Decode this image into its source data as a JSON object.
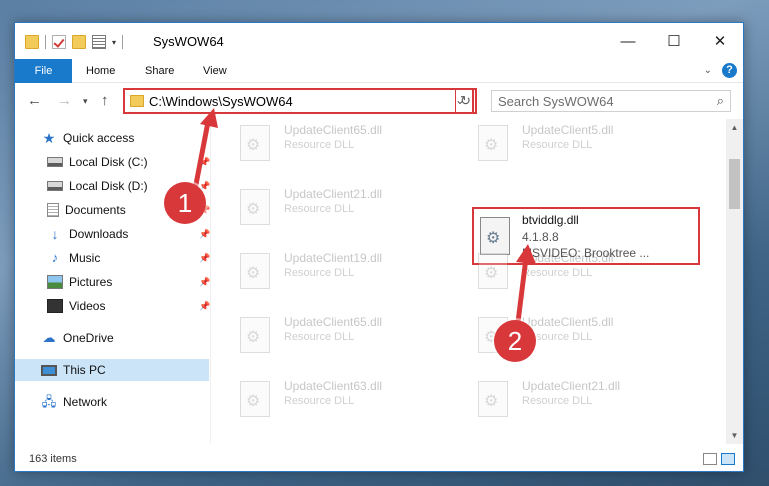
{
  "window": {
    "title": "SysWOW64",
    "controls": {
      "minimize": "—",
      "maximize": "☐",
      "close": "✕"
    }
  },
  "ribbon": {
    "tabs": [
      "File",
      "Home",
      "Share",
      "View"
    ],
    "help": "?"
  },
  "address_bar": {
    "path": "C:\\Windows\\SysWOW64",
    "search_placeholder": "Search SysWOW64"
  },
  "sidebar": {
    "items": [
      {
        "label": "Quick access",
        "icon": "star-icon"
      },
      {
        "label": "Local Disk (C:)",
        "icon": "disk-icon",
        "pinned": true
      },
      {
        "label": "Local Disk (D:)",
        "icon": "disk-icon",
        "pinned": true
      },
      {
        "label": "Documents",
        "icon": "documents-icon",
        "pinned": true
      },
      {
        "label": "Downloads",
        "icon": "downloads-icon",
        "pinned": true
      },
      {
        "label": "Music",
        "icon": "music-icon",
        "pinned": true
      },
      {
        "label": "Pictures",
        "icon": "pictures-icon",
        "pinned": true
      },
      {
        "label": "Videos",
        "icon": "videos-icon",
        "pinned": true
      },
      {
        "label": "OneDrive",
        "icon": "onedrive-icon"
      },
      {
        "label": "This PC",
        "icon": "this-pc-icon",
        "selected": true
      },
      {
        "label": "Network",
        "icon": "network-icon"
      }
    ]
  },
  "files": [
    {
      "name": "UpdateClient65.dll",
      "type": "Resource DLL"
    },
    {
      "name": "UpdateClient5.dll",
      "type": "Resource DLL"
    },
    {
      "name": "UpdateClient21.dll",
      "type": "Resource DLL"
    },
    {
      "name": "UpdateClient19.dll",
      "type": "Resource DLL"
    },
    {
      "name": "UpdateClient5.dll",
      "type": "Resource DLL"
    },
    {
      "name": "UpdateClient65.dll",
      "type": "Resource DLL"
    },
    {
      "name": "UpdateClient5.dll",
      "type": "Resource DLL"
    },
    {
      "name": "UpdateClient63.dll",
      "type": "Resource DLL"
    },
    {
      "name": "UpdateClient21.dll",
      "type": "Resource DLL"
    }
  ],
  "highlighted_file": {
    "name": "btviddlg.dll",
    "version": "4.1.8.8",
    "description": "MSVIDEO: Brooktree ..."
  },
  "status": {
    "item_count": "163 items"
  },
  "callouts": [
    "1",
    "2"
  ],
  "colors": {
    "accent": "#1979ca",
    "highlight": "#d9383a",
    "selection": "#cce4f7"
  }
}
